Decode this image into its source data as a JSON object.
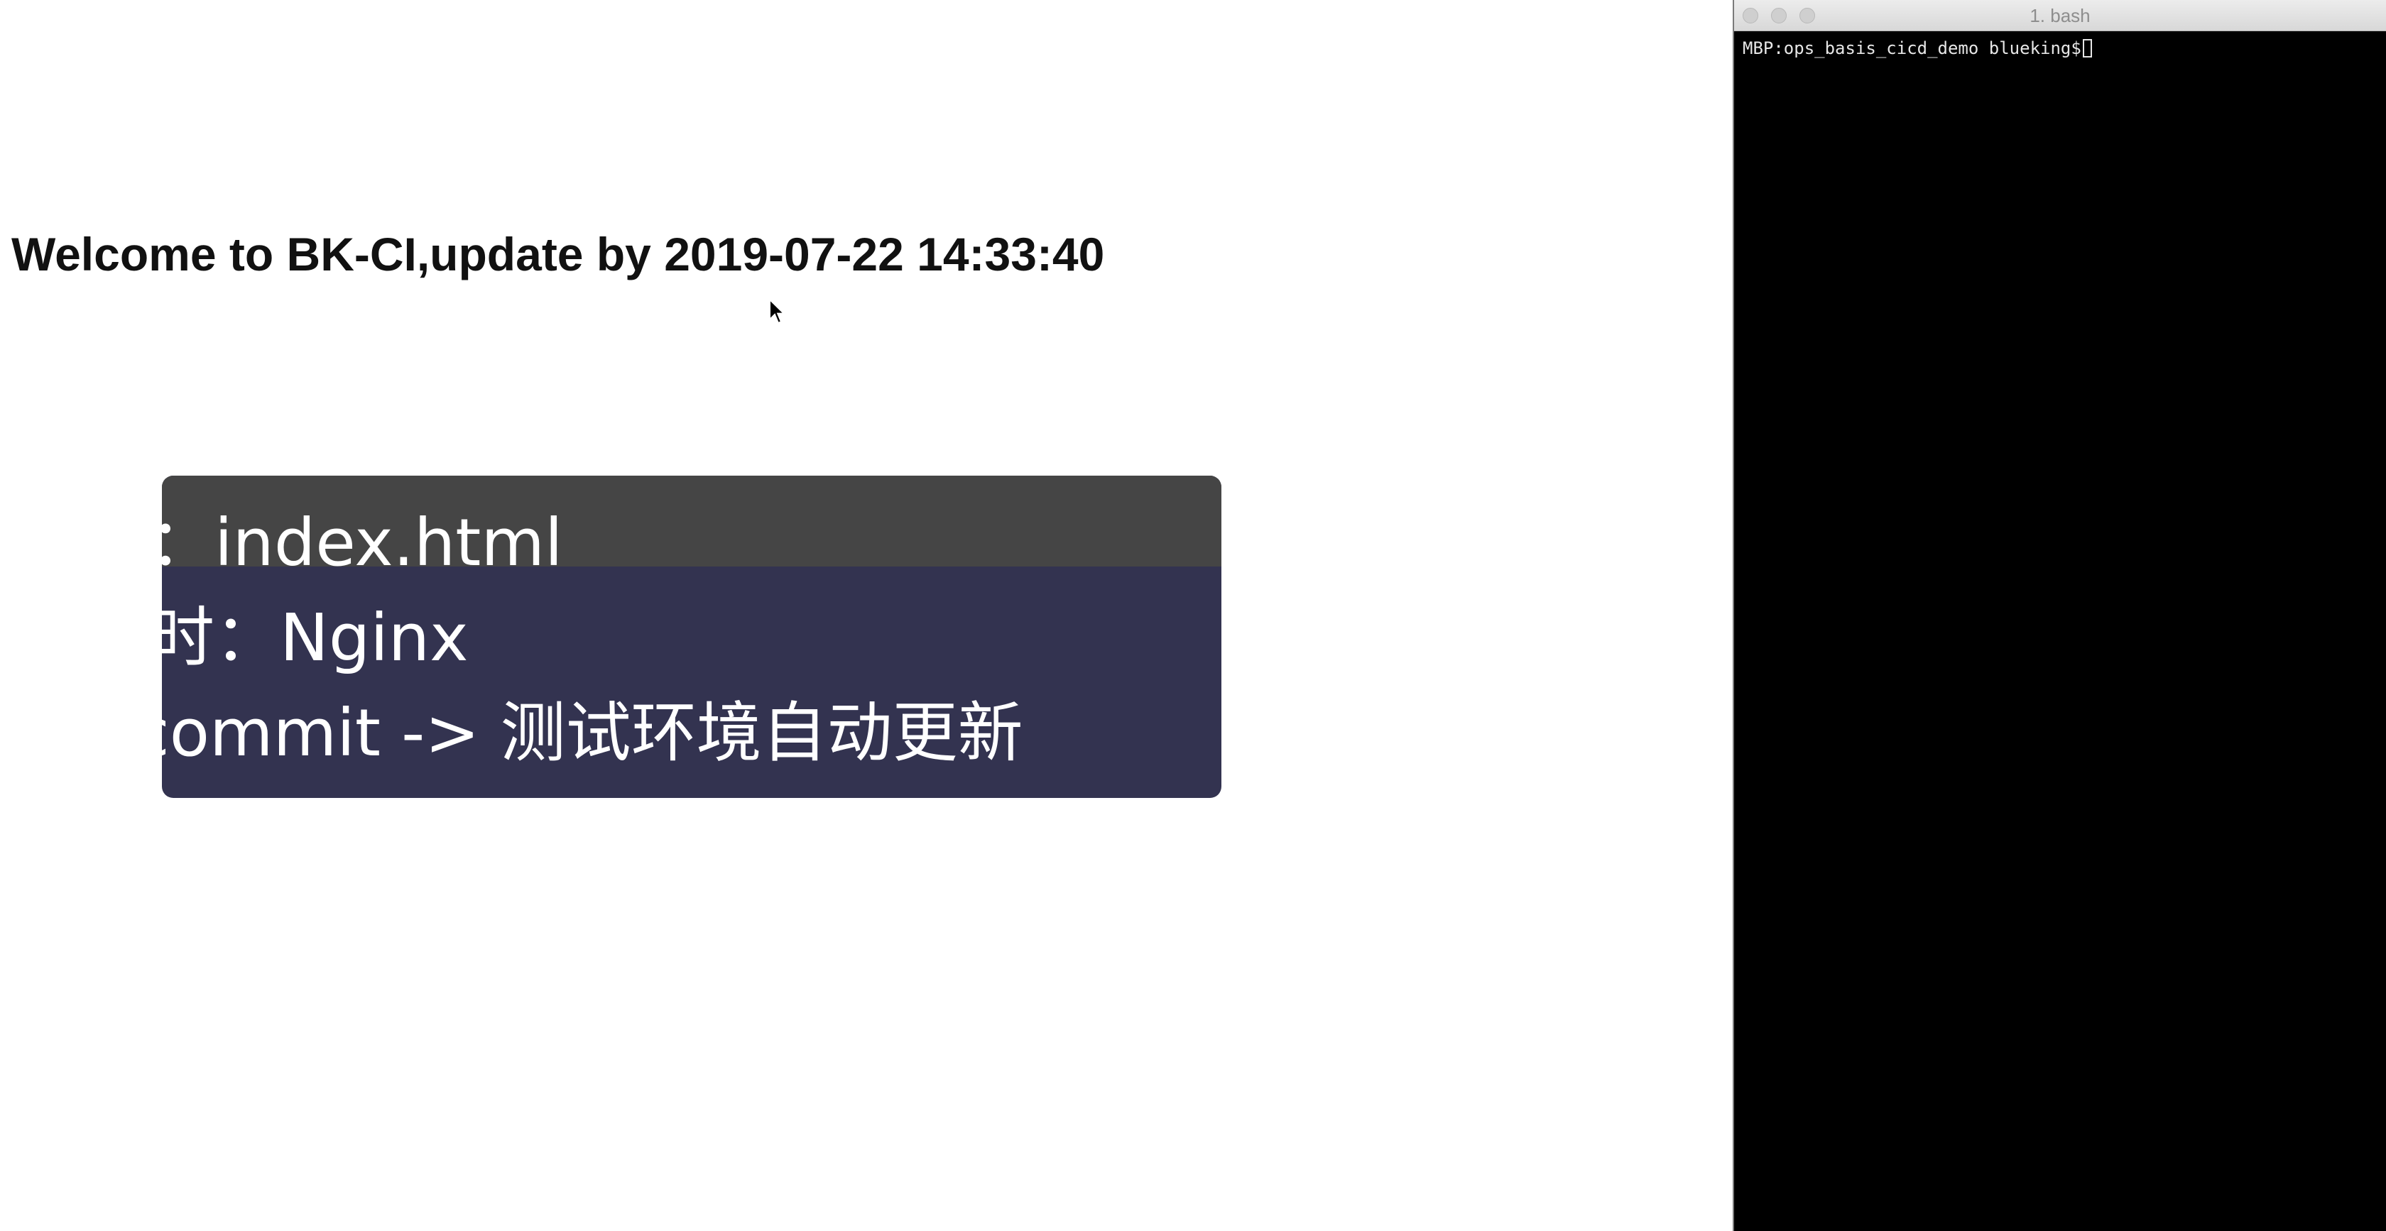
{
  "browser": {
    "heading": "Welcome to BK-CI,update by 2019-07-22 14:33:40"
  },
  "caption": {
    "line1": "代码：index.html",
    "line2": "运行时：Nginx",
    "line3": "Git commit -> 测试环境自动更新"
  },
  "terminal": {
    "title": "1. bash",
    "prompt": "MBP:ops_basis_cicd_demo blueking$",
    "colors": {
      "background": "#000000",
      "text": "#e6e6e6"
    }
  },
  "colors": {
    "caption_background": "#333350",
    "caption_top_band": "#454545",
    "page_background": "#ffffff"
  }
}
